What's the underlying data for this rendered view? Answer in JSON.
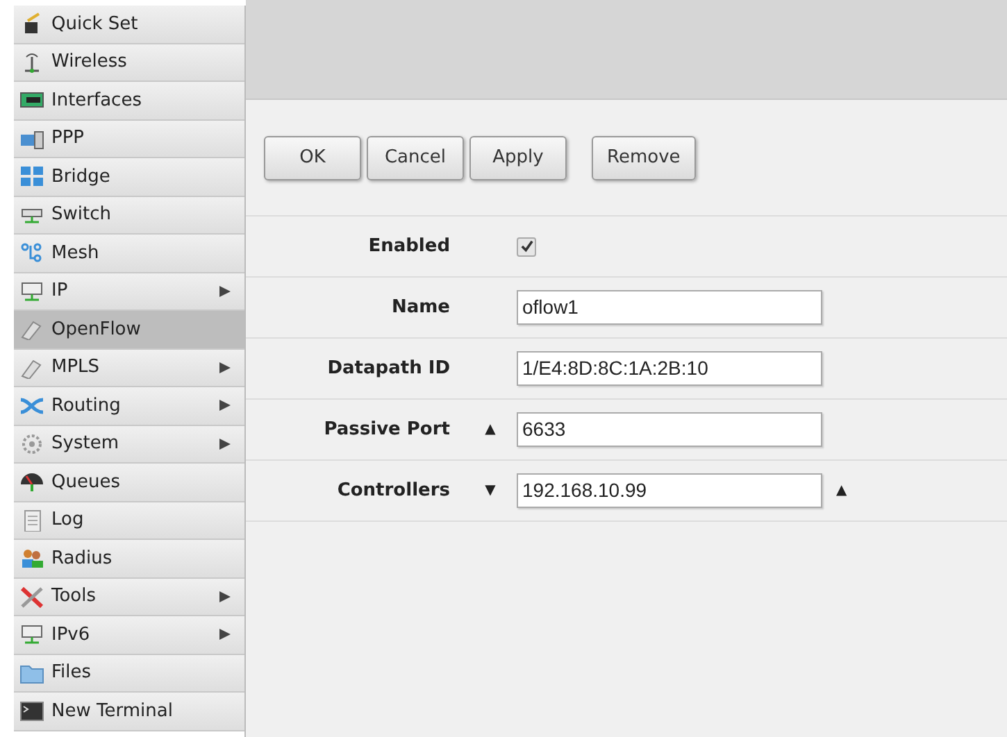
{
  "menu": [
    {
      "label": "Quick Set",
      "submenu": false,
      "selected": false
    },
    {
      "label": "Wireless",
      "submenu": false,
      "selected": false
    },
    {
      "label": "Interfaces",
      "submenu": false,
      "selected": false
    },
    {
      "label": "PPP",
      "submenu": false,
      "selected": false
    },
    {
      "label": "Bridge",
      "submenu": false,
      "selected": false
    },
    {
      "label": "Switch",
      "submenu": false,
      "selected": false
    },
    {
      "label": "Mesh",
      "submenu": false,
      "selected": false
    },
    {
      "label": "IP",
      "submenu": true,
      "selected": false
    },
    {
      "label": "OpenFlow",
      "submenu": false,
      "selected": true
    },
    {
      "label": "MPLS",
      "submenu": true,
      "selected": false
    },
    {
      "label": "Routing",
      "submenu": true,
      "selected": false
    },
    {
      "label": "System",
      "submenu": true,
      "selected": false
    },
    {
      "label": "Queues",
      "submenu": false,
      "selected": false
    },
    {
      "label": "Log",
      "submenu": false,
      "selected": false
    },
    {
      "label": "Radius",
      "submenu": false,
      "selected": false
    },
    {
      "label": "Tools",
      "submenu": true,
      "selected": false
    },
    {
      "label": "IPv6",
      "submenu": true,
      "selected": false
    },
    {
      "label": "Files",
      "submenu": false,
      "selected": false
    },
    {
      "label": "New Terminal",
      "submenu": false,
      "selected": false
    }
  ],
  "button_groups": [
    [
      {
        "label": "OK"
      },
      {
        "label": "Cancel"
      },
      {
        "label": "Apply"
      }
    ],
    [
      {
        "label": "Remove"
      }
    ]
  ],
  "fields": [
    {
      "kind": "checkbox",
      "label": "Enabled",
      "checked": true
    },
    {
      "kind": "text",
      "label": "Name",
      "value": "oflow1"
    },
    {
      "kind": "text",
      "label": "Datapath ID",
      "value": "1/E4:8D:8C:1A:2B:10"
    },
    {
      "kind": "text",
      "label": "Passive Port",
      "value": "6633",
      "prefix": "▲"
    },
    {
      "kind": "text",
      "label": "Controllers",
      "value": "192.168.10.99",
      "prefix": "▼",
      "suffix": "▲"
    }
  ]
}
